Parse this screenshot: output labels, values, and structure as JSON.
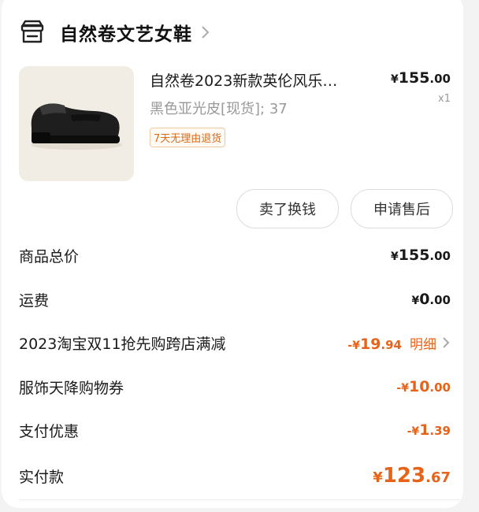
{
  "shop": {
    "name": "自然卷文艺女鞋"
  },
  "product": {
    "title": "自然卷2023新款英伦风乐…",
    "spec": "黑色亚光皮[现货]; 37",
    "price_symbol": "¥",
    "price_int": "155",
    "price_dec": ".00",
    "qty": "x1",
    "return_badge": "7天无理由退货"
  },
  "actions": {
    "sell_label": "卖了换钱",
    "after_sale_label": "申请售后"
  },
  "summary": {
    "total_label": "商品总价",
    "total_yen": "¥",
    "total_int": "155",
    "total_dec": ".00",
    "shipping_label": "运费",
    "shipping_yen": "¥",
    "shipping_int": "0",
    "shipping_dec": ".00",
    "promo_label": "2023淘宝双11抢先购跨店满减",
    "promo_yen": "-¥",
    "promo_int": "19",
    "promo_dec": ".94",
    "promo_detail": "明细",
    "coupon_label": "服饰天降购物券",
    "coupon_yen": "-¥",
    "coupon_int": "10",
    "coupon_dec": ".00",
    "pay_discount_label": "支付优惠",
    "pay_discount_yen": "-¥",
    "pay_discount_int": "1",
    "pay_discount_dec": ".39",
    "paid_label": "实付款",
    "paid_yen": "¥",
    "paid_int": "123",
    "paid_dec": ".67"
  },
  "colors": {
    "accent": "#e8631a",
    "text": "#1a1a1a",
    "muted": "#999999"
  }
}
